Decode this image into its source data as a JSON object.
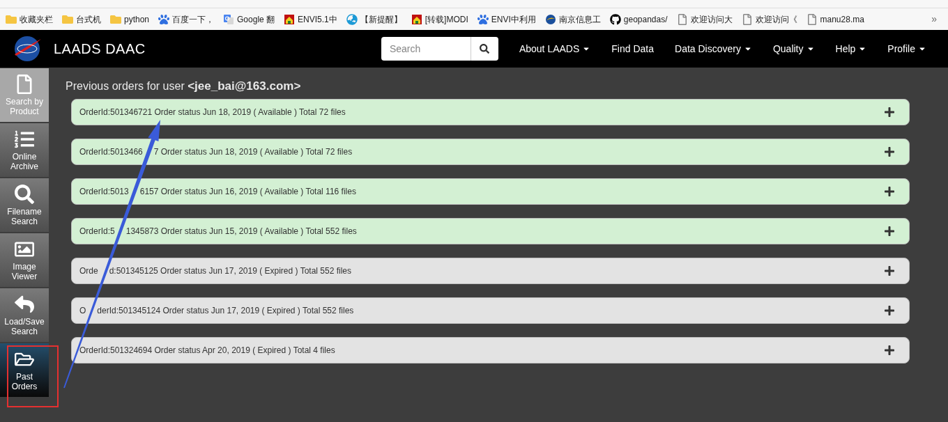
{
  "bookmarks": [
    {
      "label": "收藏夹栏",
      "kind": "folder"
    },
    {
      "label": "台式机",
      "kind": "folder"
    },
    {
      "label": "python",
      "kind": "folder"
    },
    {
      "label": "百度一下，",
      "kind": "paw"
    },
    {
      "label": "Google 翻",
      "kind": "translate"
    },
    {
      "label": "ENVI5.1中",
      "kind": "envi"
    },
    {
      "label": "【新提醒】",
      "kind": "globe"
    },
    {
      "label": "[转载]MODI",
      "kind": "envi"
    },
    {
      "label": "ENVI中利用",
      "kind": "paw"
    },
    {
      "label": "南京信息工",
      "kind": "swirl"
    },
    {
      "label": "geopandas/",
      "kind": "github"
    },
    {
      "label": "欢迎访问大",
      "kind": "page"
    },
    {
      "label": "欢迎访问《",
      "kind": "page"
    },
    {
      "label": "manu28.ma",
      "kind": "page"
    }
  ],
  "more_bookmarks": "»",
  "site_title": "LAADS DAAC",
  "search": {
    "placeholder": "Search"
  },
  "nav": [
    {
      "label": "About LAADS",
      "dropdown": true
    },
    {
      "label": "Find Data",
      "dropdown": false
    },
    {
      "label": "Data Discovery",
      "dropdown": true
    },
    {
      "label": "Quality",
      "dropdown": true
    },
    {
      "label": "Help",
      "dropdown": true
    },
    {
      "label": "Profile",
      "dropdown": true
    }
  ],
  "sidebar": [
    {
      "label": "Search by Product",
      "kind": "file",
      "selected": false
    },
    {
      "label": "Online Archive",
      "kind": "list",
      "selected": false
    },
    {
      "label": "Filename Search",
      "kind": "search",
      "selected": false
    },
    {
      "label": "Image Viewer",
      "kind": "image",
      "selected": false
    },
    {
      "label": "Load/Save Search",
      "kind": "reply",
      "selected": false
    },
    {
      "label": "Past Orders",
      "kind": "folder",
      "selected": true
    }
  ],
  "heading": {
    "prefix": "Previous orders for user ",
    "user": "<jee_bai@163.com>"
  },
  "orders": [
    {
      "segments": [
        "OrderId:501346721 Order status Jun 18, 2019 ( Available ) Total 72 files"
      ],
      "kind": "available",
      "expanded": false
    },
    {
      "segments": [
        "OrderId:5013466",
        "7 Order status Jun 18, 2019 ( Available ) Total 72 files"
      ],
      "kind": "available",
      "expanded": false
    },
    {
      "segments": [
        "OrderId:5013",
        "6157 Order status Jun 16, 2019 ( Available ) Total 116 files"
      ],
      "kind": "available",
      "expanded": false
    },
    {
      "segments": [
        "OrderId:5",
        "1345873 Order status Jun 15, 2019 ( Available ) Total 552 files"
      ],
      "kind": "available",
      "expanded": false
    },
    {
      "segments": [
        "Orde",
        "d:501345125 Order status Jun 17, 2019 ( Expired ) Total 552 files"
      ],
      "kind": "expired",
      "expanded": false
    },
    {
      "segments": [
        "O",
        "derId:501345124 Order status Jun 17, 2019 ( Expired ) Total 552 files"
      ],
      "kind": "expired",
      "expanded": false
    },
    {
      "segments": [
        "OrderId:501324694 Order status Apr 20, 2019 ( Expired ) Total 4 files"
      ],
      "kind": "expired",
      "expanded": false
    }
  ]
}
